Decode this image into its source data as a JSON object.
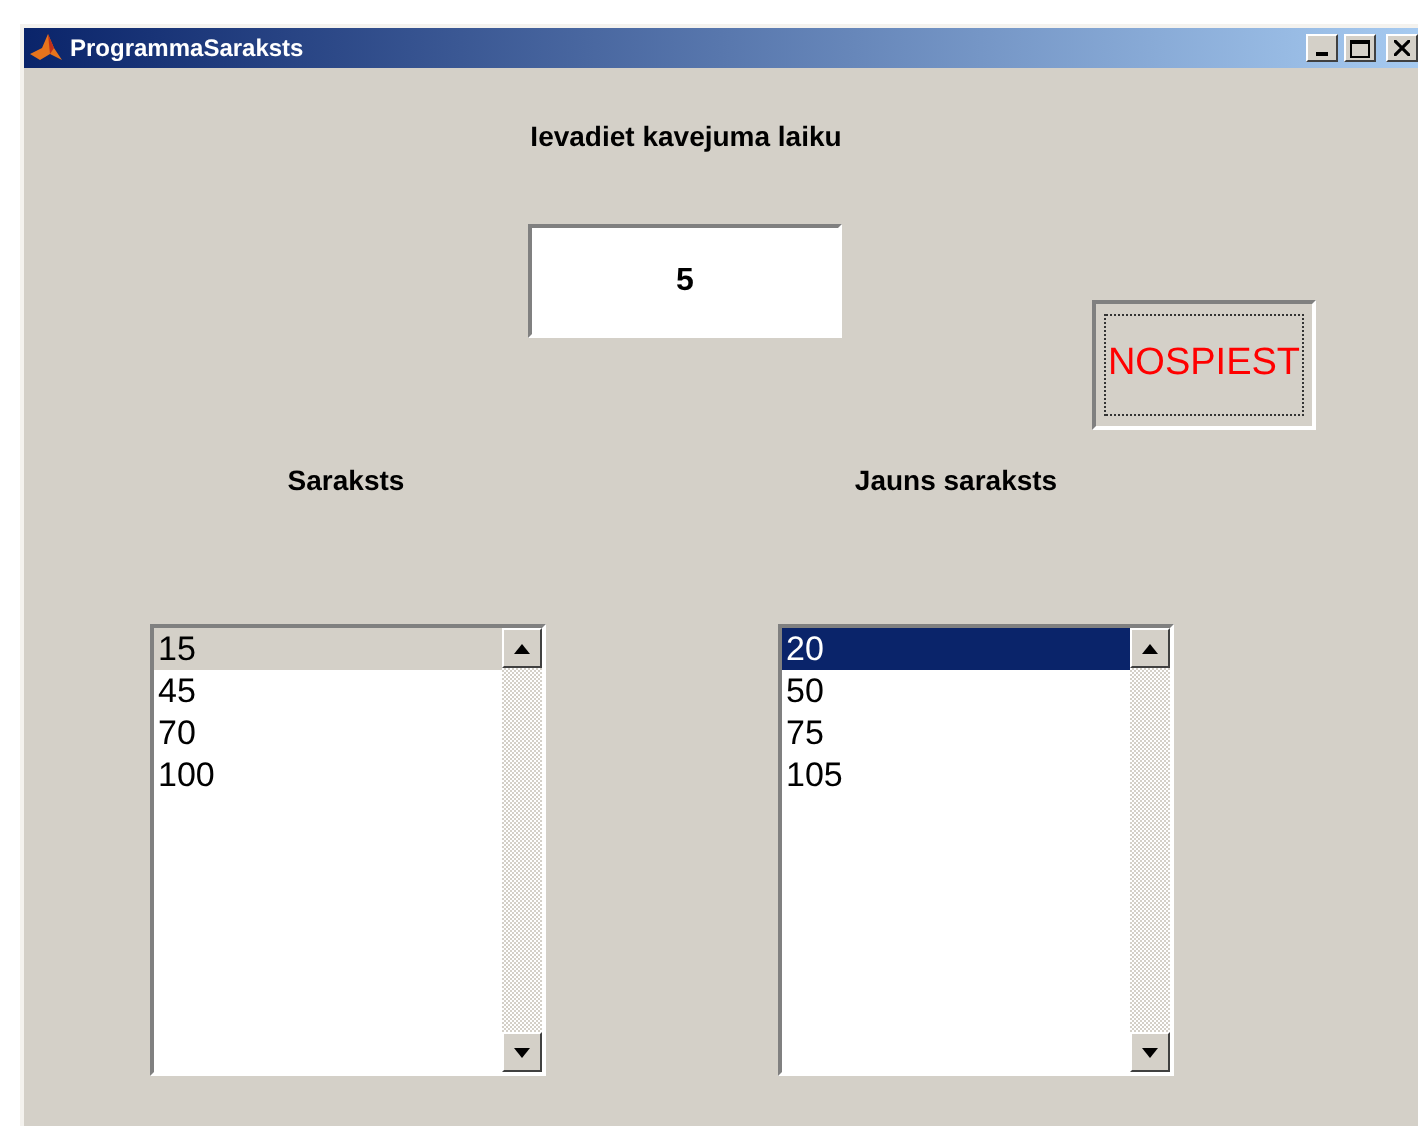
{
  "window": {
    "title": "ProgrammaSaraksts"
  },
  "prompt_label": "Ievadiet kavejuma laiku",
  "delay_field": {
    "value": "5"
  },
  "press_button": {
    "label": "NOSPIEST"
  },
  "lists": [
    {
      "label": "Saraksts",
      "focused": false,
      "items": [
        {
          "text": "15",
          "selected": true
        },
        {
          "text": "45",
          "selected": false
        },
        {
          "text": "70",
          "selected": false
        },
        {
          "text": "100",
          "selected": false
        }
      ]
    },
    {
      "label": "Jauns saraksts",
      "focused": true,
      "items": [
        {
          "text": "20",
          "selected": true
        },
        {
          "text": "50",
          "selected": false
        },
        {
          "text": "75",
          "selected": false
        },
        {
          "text": "105",
          "selected": false
        }
      ]
    }
  ]
}
